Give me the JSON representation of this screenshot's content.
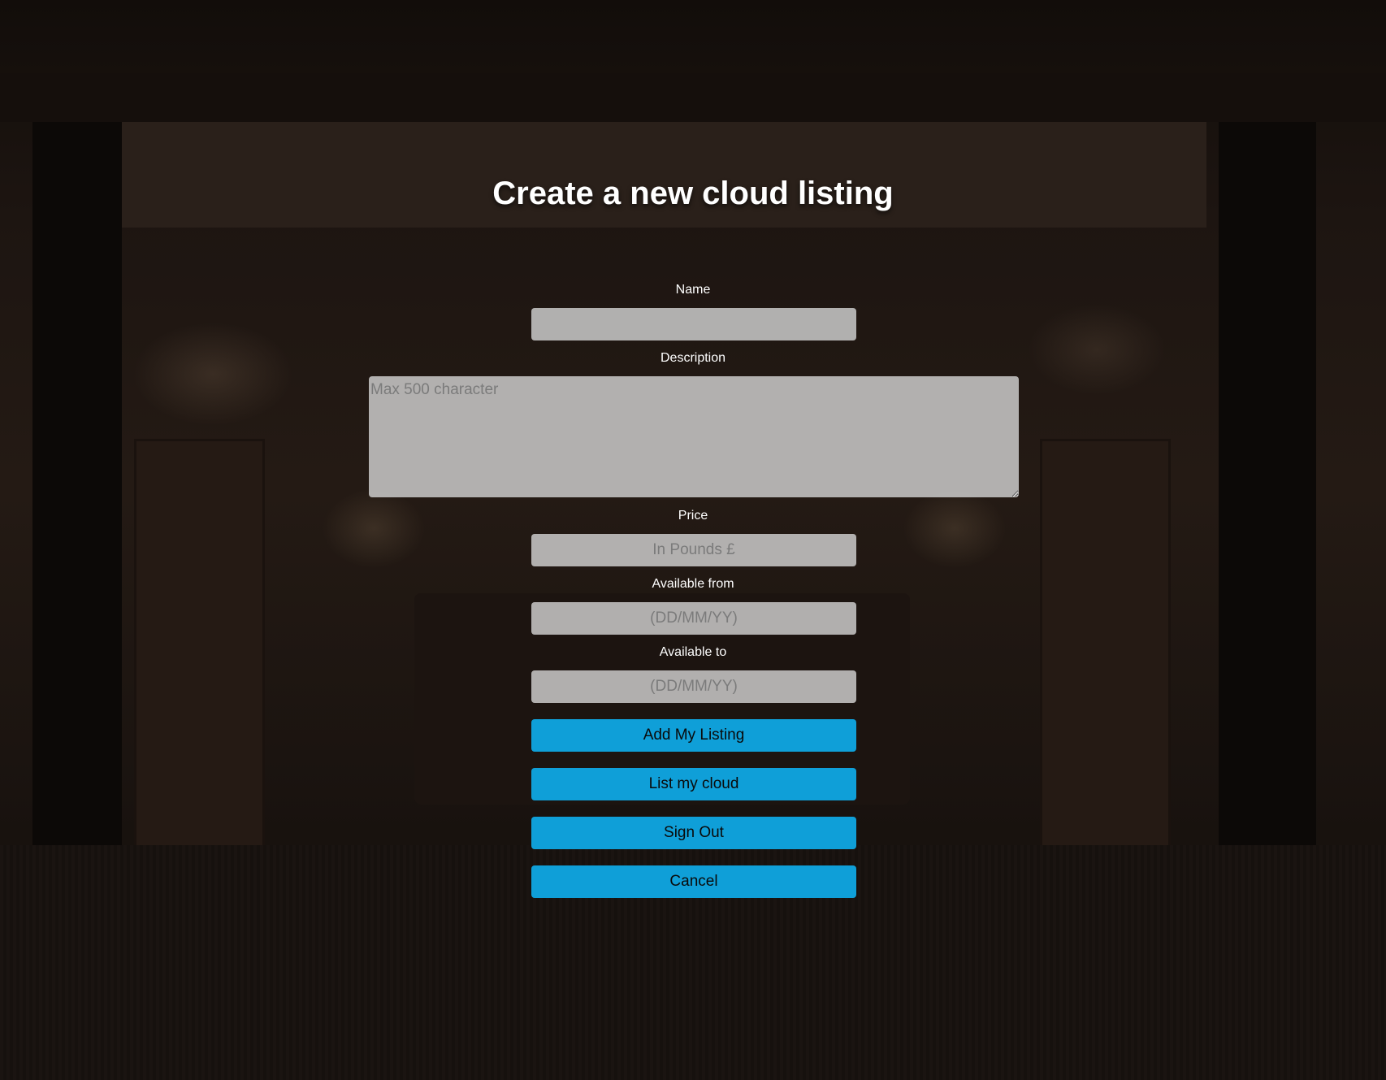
{
  "page": {
    "title": "Create a new cloud listing"
  },
  "form": {
    "name": {
      "label": "Name",
      "value": "",
      "placeholder": ""
    },
    "description": {
      "label": "Description",
      "value": "",
      "placeholder": "Max 500 character"
    },
    "price": {
      "label": "Price",
      "value": "",
      "placeholder": "In Pounds £"
    },
    "available_from": {
      "label": "Available from",
      "value": "",
      "placeholder": "(DD/MM/YY)"
    },
    "available_to": {
      "label": "Available to",
      "value": "",
      "placeholder": "(DD/MM/YY)"
    }
  },
  "buttons": {
    "add_listing": "Add My Listing",
    "list_cloud": "List my cloud",
    "sign_out": "Sign Out",
    "cancel": "Cancel"
  },
  "colors": {
    "button_bg": "#0f9fd8",
    "field_bg": "#d2d2d2",
    "title_text": "#ffffff"
  }
}
